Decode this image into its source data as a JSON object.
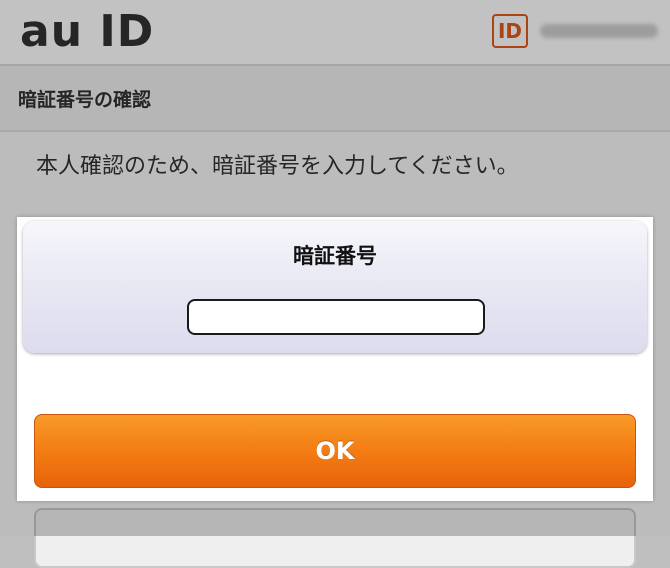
{
  "header": {
    "logo_text": "au ID",
    "id_badge_text": "ID",
    "user_id_masked": ""
  },
  "section": {
    "title": "暗証番号の確認"
  },
  "main": {
    "instruction": "本人確認のため、暗証番号を入力してください。"
  },
  "dialog": {
    "title": "暗証番号",
    "input_value": "",
    "input_placeholder": "",
    "ok_label": "OK"
  },
  "colors": {
    "brand_orange": "#f27a12",
    "id_badge": "#e05a1a",
    "text_primary": "#333333"
  }
}
